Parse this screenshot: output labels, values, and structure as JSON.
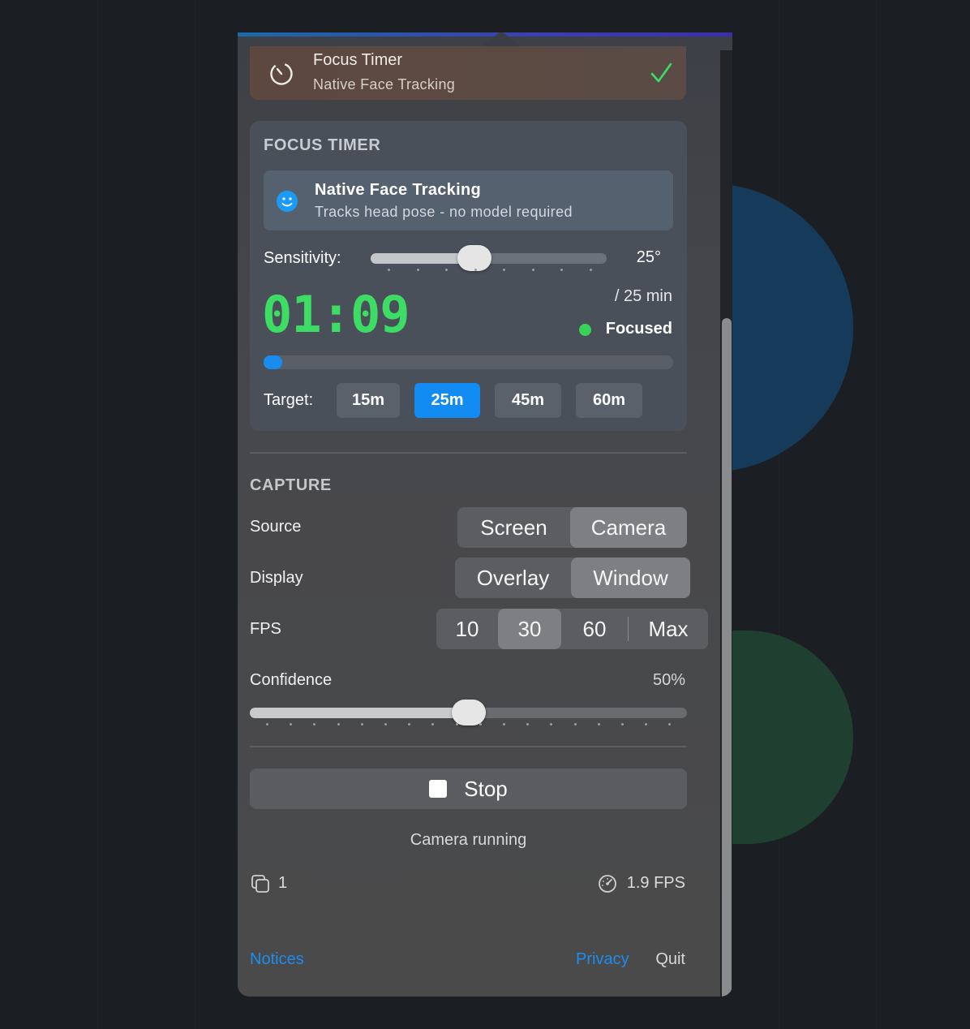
{
  "banner": {
    "title": "Focus Timer",
    "subtitle": "Native Face Tracking",
    "icon": "timer-icon",
    "check_icon": "checkmark-icon",
    "check_color": "#3ddc64"
  },
  "focus": {
    "heading": "FOCUS TIMER",
    "tracker": {
      "title": "Native Face Tracking",
      "subtitle": "Tracks head pose - no model required",
      "icon": "face-icon"
    },
    "sensitivity": {
      "label": "Sensitivity:",
      "value": "25°",
      "level": 0.44
    },
    "timer": "01:09",
    "goal": "/ 25 min",
    "status": "Focused",
    "status_color": "#38d15a",
    "progress": 0.046,
    "target_label": "Target:",
    "targets": [
      "15m",
      "25m",
      "45m",
      "60m"
    ],
    "selected_target": "25m"
  },
  "capture": {
    "heading": "CAPTURE",
    "source": {
      "label": "Source",
      "options": [
        "Screen",
        "Camera"
      ],
      "selected": "Camera"
    },
    "display": {
      "label": "Display",
      "options": [
        "Overlay",
        "Window"
      ],
      "selected": "Window"
    },
    "fps": {
      "label": "FPS",
      "options": [
        "10",
        "30",
        "60",
        "Max"
      ],
      "selected": "30"
    },
    "confidence": {
      "label": "Confidence",
      "value": "50%",
      "level": 0.5
    }
  },
  "controls": {
    "stop_label": "Stop",
    "status": "Camera running",
    "count": "1",
    "fps_readout": "1.9 FPS"
  },
  "footer": {
    "notices": "Notices",
    "privacy": "Privacy",
    "quit": "Quit"
  },
  "colors": {
    "accent": "#128cf2",
    "timer": "#3ddc64"
  }
}
